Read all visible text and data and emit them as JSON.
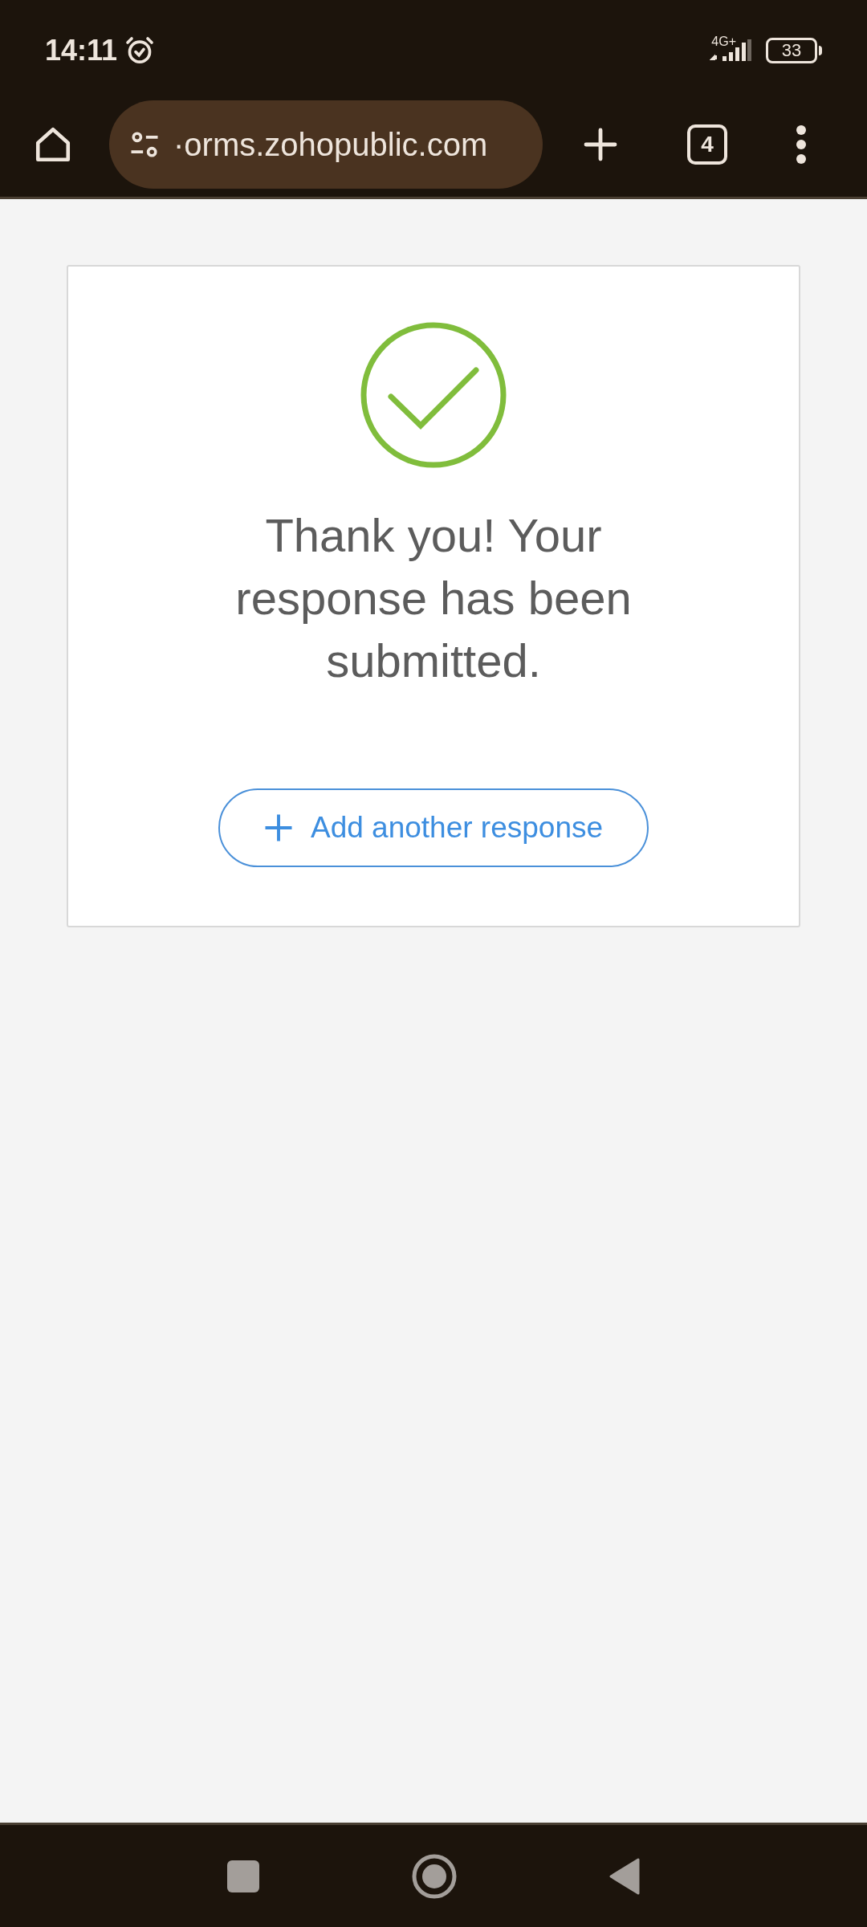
{
  "status_bar": {
    "time": "14:11",
    "network": "4G+",
    "battery": "33"
  },
  "browser": {
    "url": "·orms.zohopublic.com",
    "tab_count": "4"
  },
  "confirmation": {
    "message": "Thank you! Your response has been submitted.",
    "button": "Add another response"
  }
}
